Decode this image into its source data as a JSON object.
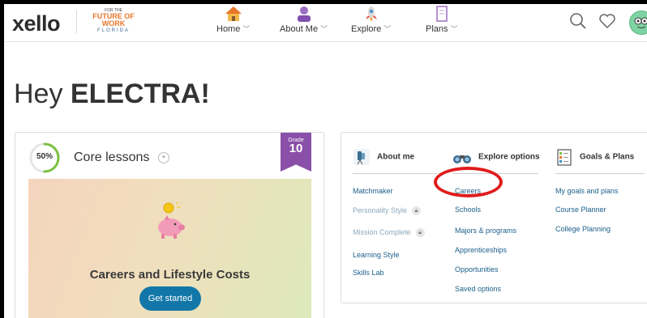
{
  "header": {
    "logo": "xello",
    "partner": {
      "line1": "FOR THE",
      "line2": "FUTURE OF WORK",
      "line3": "FLORIDA"
    },
    "nav": [
      {
        "label": "Home",
        "icon": "home-icon"
      },
      {
        "label": "About Me",
        "icon": "person-icon"
      },
      {
        "label": "Explore",
        "icon": "rocket-icon"
      },
      {
        "label": "Plans",
        "icon": "notebook-icon"
      }
    ],
    "chevron": "﹀"
  },
  "greeting": {
    "hey": "Hey",
    "name": "ELECTRA!"
  },
  "lesson_card": {
    "progress": "50%",
    "progress_value": 0.5,
    "title": "Core lessons",
    "grade_label": "Grade",
    "grade_value": "10",
    "tile_title": "Careers and Lifestyle Costs",
    "button": "Get started"
  },
  "links_card": {
    "about_me": {
      "heading": "About me",
      "links": [
        "Matchmaker",
        "Personality Style",
        "Mission Complete",
        "Learning Style",
        "Skills Lab"
      ]
    },
    "explore": {
      "heading": "Explore options",
      "links": [
        "Careers",
        "Schools",
        "Majors & programs",
        "Apprenticeships",
        "Opportunities",
        "Saved options"
      ]
    },
    "goals": {
      "heading": "Goals & Plans",
      "links": [
        "My goals and plans",
        "Course Planner",
        "College Planning"
      ]
    }
  },
  "colors": {
    "accent_blue": "#1277a8",
    "grade_purple": "#8a4fa8",
    "progress_green": "#7cc142",
    "annotation_red": "#e01b1b"
  }
}
